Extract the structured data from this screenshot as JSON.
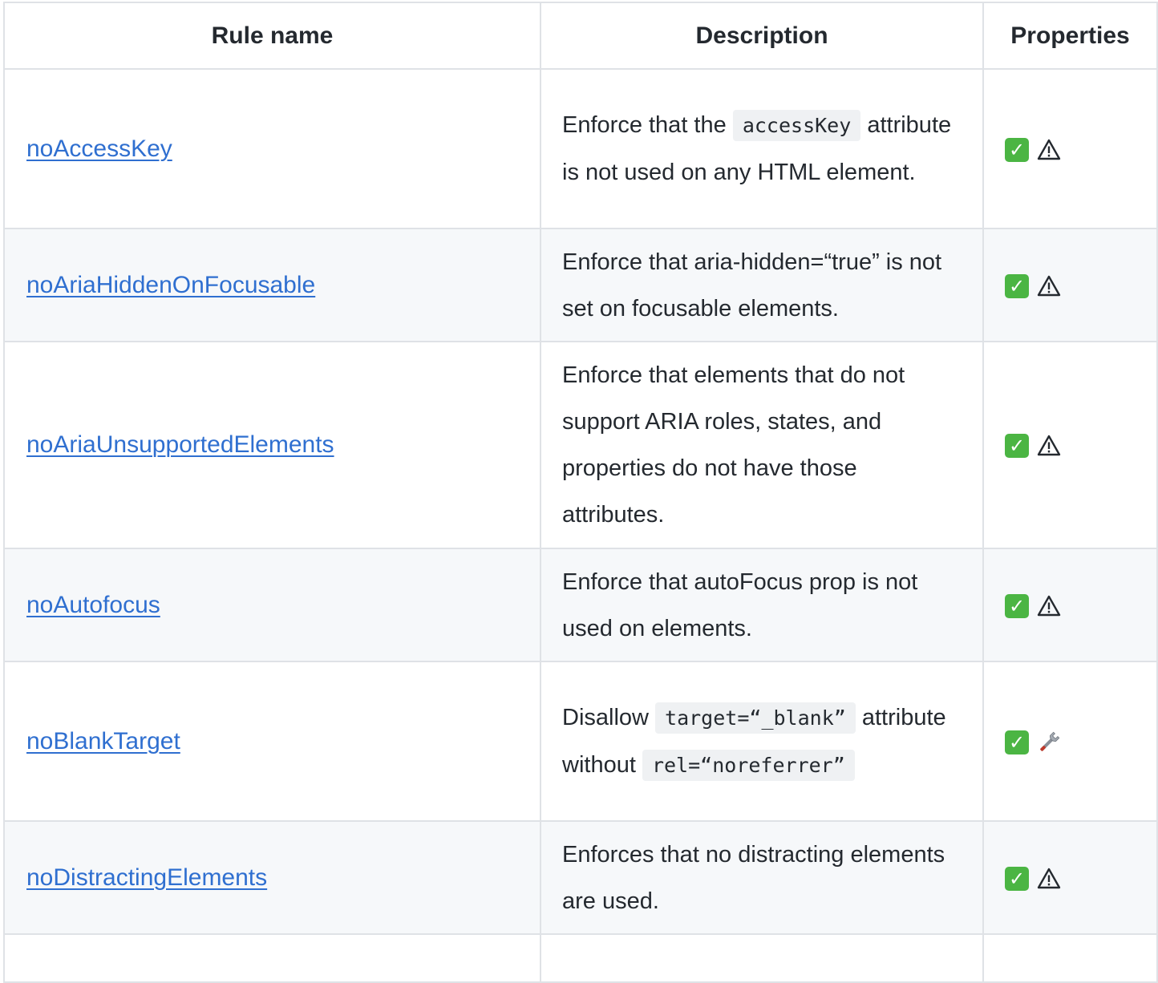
{
  "table": {
    "headers": {
      "rule_name": "Rule name",
      "description": "Description",
      "properties": "Properties"
    },
    "rows": [
      {
        "name": "noAccessKey",
        "desc_before": "Enforce that the ",
        "desc_code": "accessKey",
        "desc_after": " attribute is not used on any HTML element.",
        "icons": [
          "check-icon",
          "warning-icon"
        ]
      },
      {
        "name": "noAriaHiddenOnFocusable",
        "desc_before": "Enforce that aria-hidden=“true” is not set on focusable elements.",
        "icons": [
          "check-icon",
          "warning-icon"
        ]
      },
      {
        "name": "noAriaUnsupportedElements",
        "desc_before": "Enforce that elements that do not support ARIA roles, states, and properties do not have those attributes.",
        "icons": [
          "check-icon",
          "warning-icon"
        ]
      },
      {
        "name": "noAutofocus",
        "desc_before": "Enforce that autoFocus prop is not used on elements.",
        "icons": [
          "check-icon",
          "warning-icon"
        ]
      },
      {
        "name": "noBlankTarget",
        "desc_before": "Disallow ",
        "desc_code": "target=“_blank”",
        "desc_after": " attribute without ",
        "desc_code2": "rel=“noreferrer”",
        "icons": [
          "check-icon",
          "wrench-icon"
        ]
      },
      {
        "name": "noDistractingElements",
        "desc_before": "Enforces that no distracting elements are used.",
        "icons": [
          "check-icon",
          "warning-icon"
        ]
      }
    ]
  },
  "colors": {
    "link": "#2f6fd0",
    "border": "#dfe2e6",
    "row_alt_bg": "#f6f8fa",
    "check_bg": "#4bb543"
  }
}
